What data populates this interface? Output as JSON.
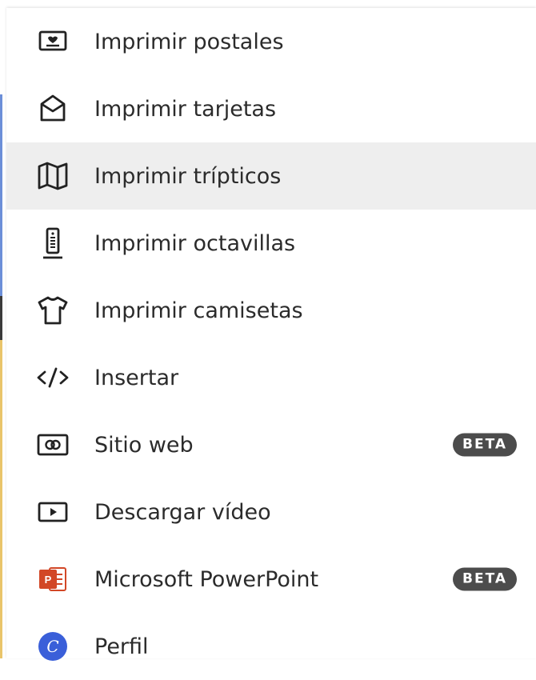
{
  "menu": {
    "items": [
      {
        "label": "Imprimir postales",
        "icon": "postcard-icon"
      },
      {
        "label": "Imprimir tarjetas",
        "icon": "card-envelope-icon"
      },
      {
        "label": "Imprimir trípticos",
        "icon": "map-icon",
        "active": true
      },
      {
        "label": "Imprimir octavillas",
        "icon": "flyer-stand-icon"
      },
      {
        "label": "Imprimir camisetas",
        "icon": "tshirt-icon"
      },
      {
        "label": "Insertar",
        "icon": "code-icon"
      },
      {
        "label": "Sitio web",
        "icon": "website-icon",
        "badge": "BETA"
      },
      {
        "label": "Descargar vídeo",
        "icon": "video-play-icon"
      },
      {
        "label": "Microsoft PowerPoint",
        "icon": "powerpoint-icon",
        "badge": "BETA"
      },
      {
        "label": "Perfil",
        "icon": "avatar-icon",
        "avatar_letter": "C"
      }
    ]
  },
  "colors": {
    "active_row": "#eeeeee",
    "badge": "#4c4c4c",
    "powerpoint": "#d24726",
    "avatar": "#3a5fd9"
  }
}
